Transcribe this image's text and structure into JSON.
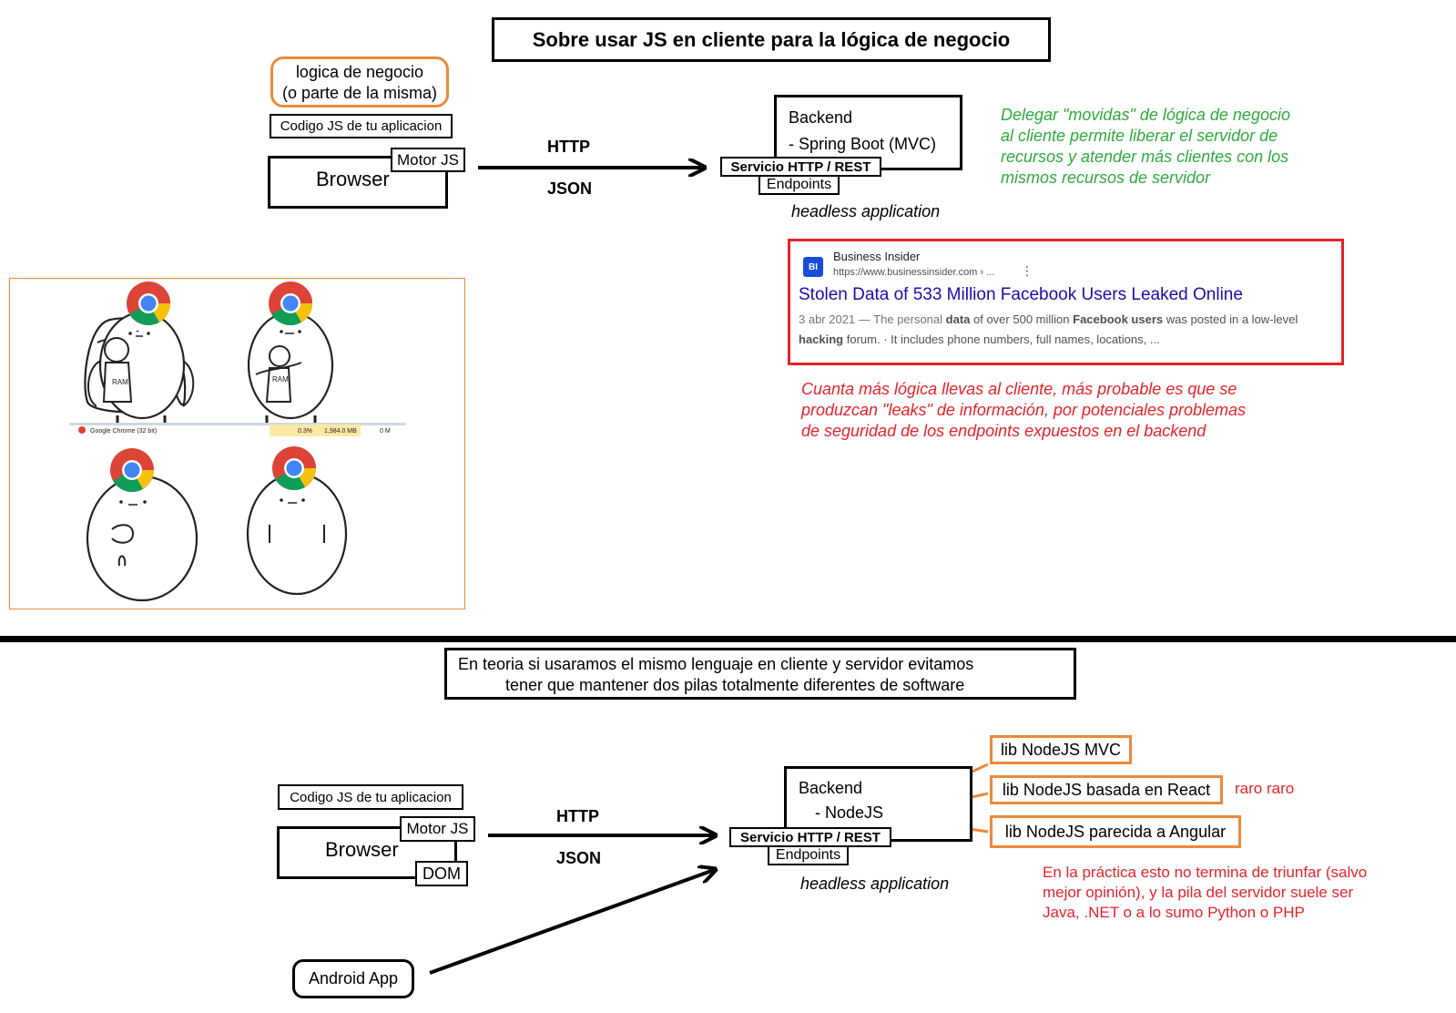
{
  "top": {
    "title": "Sobre usar JS en cliente para la lógica de negocio",
    "business_logic_line1": "logica de negocio",
    "business_logic_line2": "(o parte de la misma)",
    "js_code_label": "Codigo JS de tu aplicacion",
    "browser_label": "Browser",
    "js_engine_label": "Motor JS",
    "http_label": "HTTP",
    "json_label": "JSON",
    "backend_title": "Backend",
    "backend_item": "- Spring Boot (MVC)",
    "service_label": "Servicio HTTP / REST",
    "endpoints_label": "Endpoints",
    "headless_label": "headless application",
    "green_note": [
      "Delegar \"movidas\" de lógica de negocio",
      "al cliente permite liberar el servidor de",
      "recursos y atender más clientes con los",
      "mismos recursos de servidor"
    ],
    "red_note": [
      "Cuanta más lógica llevas al cliente, más probable es que se",
      "produzcan \"leaks\" de información, por potenciales problemas",
      "de seguridad de los endpoints expuestos en el backend"
    ]
  },
  "search_result": {
    "logo_text": "BI",
    "source": "Business Insider",
    "url": "https://www.businessinsider.com › ...",
    "menu_glyph": "⋮",
    "headline": "Stolen Data of 533 Million Facebook Users Leaked Online",
    "snippet_line1_parts": [
      "3 abr 2021 — The personal ",
      "data",
      " of over 500 million ",
      "Facebook users",
      " was posted in a low-level"
    ],
    "snippet_line2_parts": [
      "hacking",
      " forum. · It includes phone numbers, full names, locations, ..."
    ]
  },
  "meme": {
    "ram_label_1": "RAM",
    "ram_label_2": "RAM",
    "taskbar_app": "Google Chrome (32 bit)",
    "taskbar_cpu": "0.3%",
    "taskbar_mem": "1,984.0 MB",
    "taskbar_disk": "0 M"
  },
  "bottom": {
    "title_line1": "En teoria si usaramos el mismo lenguaje en cliente y servidor evitamos",
    "title_line2": "tener que mantener dos pilas totalmente diferentes de software",
    "js_code_label": "Codigo JS de tu aplicacion",
    "browser_label": "Browser",
    "js_engine_label": "Motor JS",
    "dom_label": "DOM",
    "http_label": "HTTP",
    "json_label": "JSON",
    "backend_title": "Backend",
    "backend_item": "- NodeJS",
    "service_label": "Servicio HTTP / REST",
    "endpoints_label": "Endpoints",
    "headless_label": "headless application",
    "lib_mvc": "lib NodeJS MVC",
    "lib_react": "lib NodeJS basada en React",
    "lib_angular": "lib NodeJS parecida a Angular",
    "raro_note": "raro raro",
    "android_label": "Android App",
    "red_note": [
      "En la práctica esto no termina de triunfar (salvo",
      "mejor opinión), y la pila del servidor suele ser",
      "Java, .NET o a lo sumo Python o PHP"
    ]
  },
  "colors": {
    "orange": "#ec8a3a",
    "green": "#2eaa3c",
    "red": "#e4232b",
    "link_blue": "#1a0dab",
    "chrome_red": "#db4437",
    "chrome_yellow": "#f4c20d",
    "chrome_green": "#0f9d58",
    "chrome_blue": "#4285f4"
  }
}
